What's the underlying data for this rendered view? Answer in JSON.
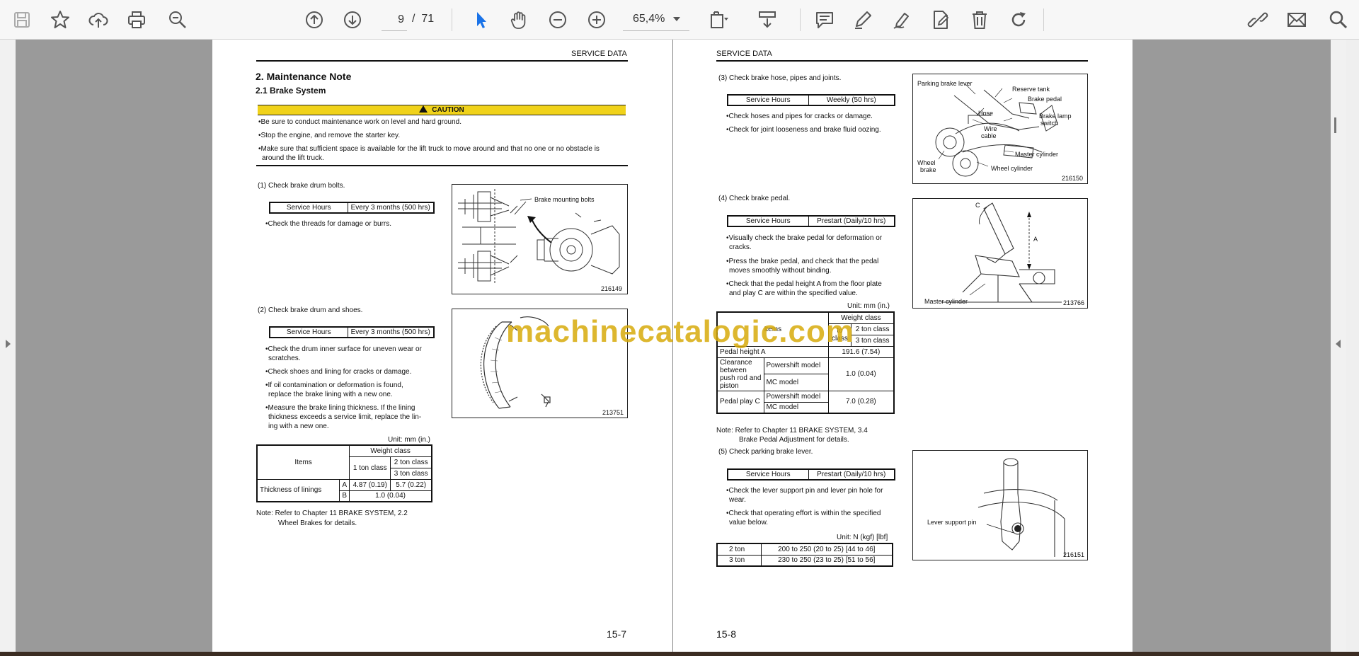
{
  "toolbar": {
    "current_page": "9",
    "page_separator": "/",
    "total_pages": "71",
    "zoom": "65,4%"
  },
  "watermark": "machinecatalogic.com",
  "left_page": {
    "header": "SERVICE DATA",
    "section_title": "2.  Maintenance Note",
    "subsection_title": "2.1   Brake System",
    "caution_label": "CAUTION",
    "caution_items": [
      "•Be sure to conduct maintenance work on level and hard ground.",
      "•Stop the engine, and remove the starter key.",
      "•Make sure that sufficient space is available for the lift truck to move around and that no one or no obstacle is",
      "around the lift truck."
    ],
    "item1": {
      "title": "(1)  Check brake drum bolts.",
      "service_hours_label": "Service Hours",
      "service_hours_value": "Every 3 months (500 hrs)",
      "bullets": [
        "•Check the threads for damage or burrs."
      ],
      "figure_label": "Brake mounting bolts",
      "figure_number": "216149"
    },
    "item2": {
      "title": "(2)  Check brake drum and shoes.",
      "service_hours_label": "Service Hours",
      "service_hours_value": "Every 3 months (500 hrs)",
      "bullets": [
        "•Check the drum inner surface for uneven wear or",
        "scratches.",
        "•Check shoes and lining for cracks or damage.",
        "•If oil contamination or deformation is found,",
        "replace the brake lining with a new one.",
        "•Measure the brake lining thickness. If the lining",
        "thickness exceeds a service limit, replace the lin-",
        "ing with a new one."
      ],
      "figure_number": "213751"
    },
    "table": {
      "unit": "Unit: mm (in.)",
      "items_header": "Items",
      "weight_class": "Weight class",
      "class1": "1 ton class",
      "class2": "2 ton class",
      "class3": "3 ton class",
      "row_label": "Thickness of linings",
      "row_a": "A",
      "row_b": "B",
      "a_val1": "4.87 (0.19)",
      "a_val2": "5.7 (0.22)",
      "b_val": "1.0 (0.04)"
    },
    "note_line1": "Note:  Refer  to  Chapter  11  BRAKE  SYSTEM,  2.2",
    "note_line2": "Wheel Brakes for details.",
    "page_number": "15-7"
  },
  "right_page": {
    "header": "SERVICE DATA",
    "item3": {
      "title": "(3)  Check brake hose, pipes and joints.",
      "service_hours_label": "Service Hours",
      "service_hours_value": "Weekly (50 hrs)",
      "bullets": [
        "•Check hoses and pipes for cracks or damage.",
        "•Check for joint looseness and brake fluid oozing."
      ],
      "figure_labels": {
        "parking": "Parking brake lever",
        "reserve": "Reserve tank",
        "pedal": "Brake pedal",
        "hose": "Hose",
        "lamp1": "Brake lamp",
        "lamp2": "switch",
        "wire1": "Wire",
        "wire2": "cable",
        "master": "Master cylinder",
        "wheel1": "Wheel",
        "wheel2": "brake",
        "wheelcyl": "Wheel cylinder"
      },
      "figure_number": "216150"
    },
    "item4": {
      "title": "(4)  Check brake pedal.",
      "service_hours_label": "Service Hours",
      "service_hours_value": "Prestart (Daily/10 hrs)",
      "bullets": [
        "•Visually check the brake pedal for deformation or",
        "cracks.",
        "•Press the brake pedal, and check that the pedal",
        "moves smoothly without binding.",
        "•Check that the pedal height A from the floor plate",
        "and play C are within the specified value."
      ],
      "figure_labels": {
        "c": "C",
        "a": "A",
        "master": "Master cylinder"
      },
      "figure_number": "213766"
    },
    "table": {
      "unit": "Unit: mm (in.)",
      "weight_class": "Weight class",
      "items_header": "Items",
      "class_to1": "to",
      "class_ton": "class",
      "class2": "2 ton class",
      "class3": "3 ton class",
      "pedal_height": "Pedal height A",
      "pedal_height_val": "191.6 (7.54)",
      "clearance": "Clearance between push rod and piston",
      "powershift": "Powershift model",
      "mc": "MC model",
      "clearance_val": "1.0 (0.04)",
      "pedal_play": "Pedal play C",
      "pedal_play_val": "7.0 (0.28)"
    },
    "note_line1": "Note:  Refer  to  Chapter  11  BRAKE  SYSTEM,  3.4",
    "note_line2": "Brake Pedal Adjustment for details.",
    "item5": {
      "title": "(5)  Check parking brake lever.",
      "service_hours_label": "Service Hours",
      "service_hours_value": "Prestart (Daily/10 hrs)",
      "bullets": [
        "•Check the lever support pin and lever pin hole for",
        "wear.",
        "•Check that operating effort is within the specified",
        "value below."
      ],
      "figure_label": "Lever support pin",
      "figure_number": "216151"
    },
    "effort_table": {
      "unit": "Unit: N (kgf) [lbf]",
      "rows": [
        {
          "label": "2 ton",
          "value": "200 to 250 (20 to 25) [44 to 46]"
        },
        {
          "label": "3 ton",
          "value": "230 to 250 (23 to 25) [51 to 56]"
        }
      ]
    },
    "page_number": "15-8"
  }
}
